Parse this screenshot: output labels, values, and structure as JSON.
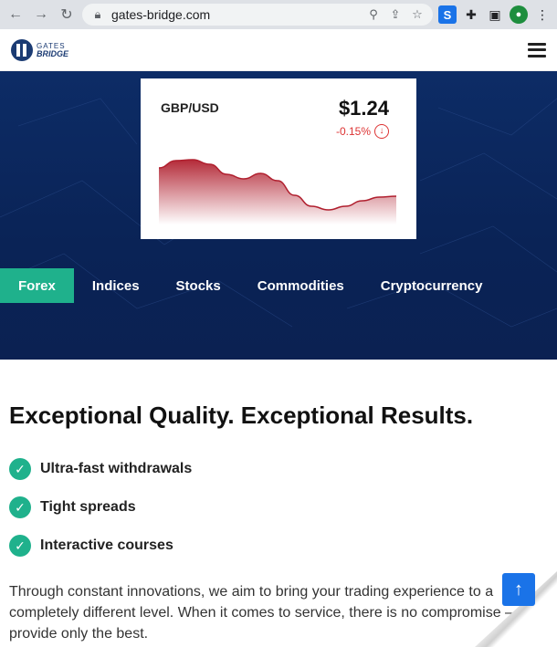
{
  "browser": {
    "url": "gates-bridge.com",
    "back_icon": "arrow-left-icon",
    "forward_icon": "arrow-right-icon",
    "reload_icon": "reload-icon",
    "lock_icon": "lock-icon",
    "zoom_icon": "search-icon",
    "share_icon": "share-icon",
    "star_icon": "star-icon",
    "ext_s_label": "S",
    "puzzle_icon": "puzzle-icon",
    "sidepanel_icon": "side-panel-icon",
    "avatar_icon": "profile-icon",
    "menu_icon": "kebab-menu-icon"
  },
  "header": {
    "logo_line1": "GATES",
    "logo_line2": "BRIDGE",
    "menu_icon": "hamburger-icon"
  },
  "ticker": {
    "pair": "GBP/USD",
    "price": "$1.24",
    "change": "-0.15%",
    "change_icon": "arrow-down-circle-icon",
    "down_color": "#cc2b2b"
  },
  "chart_data": {
    "type": "area",
    "series": [
      {
        "values": [
          0.62,
          0.7,
          0.71,
          0.66,
          0.55,
          0.5,
          0.56,
          0.48,
          0.32,
          0.2,
          0.16,
          0.2,
          0.26,
          0.3,
          0.31
        ]
      }
    ],
    "ylim": [
      0,
      1
    ],
    "grid": false,
    "color": "#b01f2e"
  },
  "tabs": [
    {
      "label": "Forex",
      "active": true
    },
    {
      "label": "Indices",
      "active": false
    },
    {
      "label": "Stocks",
      "active": false
    },
    {
      "label": "Commodities",
      "active": false
    },
    {
      "label": "Cryptocurrency",
      "active": false
    }
  ],
  "main": {
    "headline": "Exceptional Quality. Exceptional Results.",
    "features": [
      {
        "label": "Ultra-fast withdrawals",
        "icon": "check-circle-icon"
      },
      {
        "label": "Tight spreads",
        "icon": "check-circle-icon"
      },
      {
        "label": "Interactive courses",
        "icon": "check-circle-icon"
      }
    ],
    "body": "Through constant innovations, we aim to bring your trading experience to a completely different level. When it comes to service, there is no compromise — we provide only the best."
  },
  "scroll_top_icon": "arrow-up-icon",
  "colors": {
    "accent": "#1fb18c",
    "hero_bg": "#0d2c66",
    "button_blue": "#1a73e8"
  }
}
